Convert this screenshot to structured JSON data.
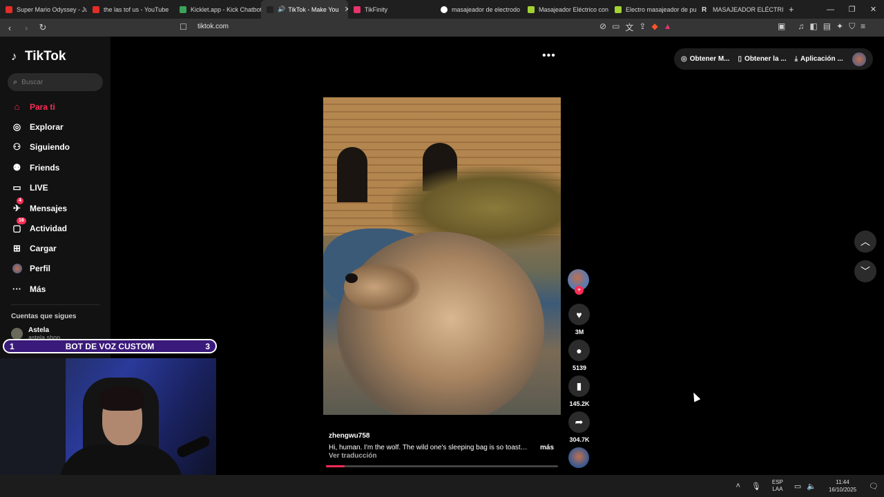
{
  "browser": {
    "tabs": [
      {
        "title": "Super Mario Odyssey - Jur",
        "color": "#e52d27"
      },
      {
        "title": "the las tof us - YouTube",
        "color": "#e52d27"
      },
      {
        "title": "Kicklet.app - Kick Chatbot",
        "color": "#3aa35b"
      },
      {
        "title": "TikTok - Make You",
        "color": "#222222"
      },
      {
        "title": "TikFinity",
        "color": "#e8336b"
      },
      {
        "title": "masajeador de electrodo",
        "color": "#ffffff"
      },
      {
        "title": "Masajeador Eléctrico con",
        "color": "#a4d233"
      },
      {
        "title": "Electro masajeador de pul",
        "color": "#a4d233"
      },
      {
        "title": "MASAJEADOR ELÉCTRICO",
        "color": "#dddddd"
      }
    ],
    "active_tab_index": 3,
    "new_tab": "+",
    "url": "tiktok.com",
    "window_controls": {
      "minimize": "—",
      "maximize": "❐",
      "close": "✕"
    }
  },
  "sidebar": {
    "logo": "TikTok",
    "search_placeholder": "Buscar",
    "items": [
      {
        "label": "Para ti",
        "icon": "home-icon"
      },
      {
        "label": "Explorar",
        "icon": "compass-icon"
      },
      {
        "label": "Siguiendo",
        "icon": "following-icon"
      },
      {
        "label": "Friends",
        "icon": "friends-icon"
      },
      {
        "label": "LIVE",
        "icon": "live-icon"
      },
      {
        "label": "Mensajes",
        "icon": "messages-icon",
        "badge": "4"
      },
      {
        "label": "Actividad",
        "icon": "activity-icon",
        "badge": "16"
      },
      {
        "label": "Cargar",
        "icon": "upload-icon"
      },
      {
        "label": "Perfil",
        "icon": "profile-icon"
      },
      {
        "label": "Más",
        "icon": "more-icon"
      }
    ],
    "following_title": "Cuentas que sigues",
    "following": [
      {
        "name": "Astela",
        "handle": "astela.shop"
      }
    ]
  },
  "overlay": {
    "banner_left": "1",
    "banner_label": "BOT DE VOZ CUSTOM",
    "banner_right": "3"
  },
  "header": {
    "buttons": [
      {
        "label": "Obtener M...",
        "icon": "coin-icon"
      },
      {
        "label": "Obtener la ...",
        "icon": "phone-icon"
      },
      {
        "label": "Aplicación ...",
        "icon": "download-icon"
      }
    ]
  },
  "video": {
    "username": "zhengwu758",
    "description": "Hi, human. I'm the wolf. The wild one's sleeping bag is so toasty ...",
    "more": "más",
    "translate": "Ver traducción",
    "progress": 0.08
  },
  "actions": {
    "likes": "3M",
    "comments": "5139",
    "saves": "145.2K",
    "shares": "304.7K"
  },
  "taskbar": {
    "lang_top": "ESP",
    "lang_bottom": "LAA",
    "time": "11:44",
    "date": "16/10/2025"
  },
  "colors": {
    "accent": "#fe2c55",
    "banner": "#3a1a7a"
  }
}
